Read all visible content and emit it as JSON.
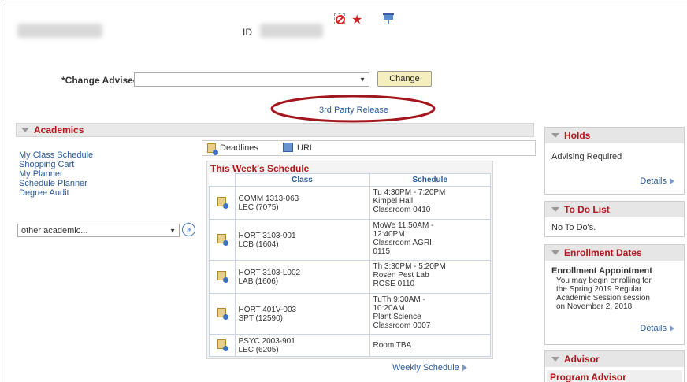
{
  "header": {
    "id_label": "ID",
    "change_advisee_label": "*Change Advisee",
    "change_button": "Change",
    "third_party_link": "3rd Party Release"
  },
  "academics": {
    "title": "Academics",
    "links": [
      "My Class Schedule",
      "Shopping Cart",
      "My Planner",
      "Schedule Planner",
      "Degree Audit"
    ],
    "other_select": "other academic...",
    "tabs": {
      "deadlines": "Deadlines",
      "url": "URL"
    },
    "schedule_title": "This Week's Schedule",
    "columns": [
      "Class",
      "Schedule"
    ],
    "rows": [
      {
        "class": [
          "COMM 1313-063",
          "LEC (7075)"
        ],
        "schedule": [
          "Tu 4:30PM - 7:20PM",
          "Kimpel Hall",
          "Classroom 0410"
        ]
      },
      {
        "class": [
          "HORT 3103-001",
          "LCB (1604)"
        ],
        "schedule": [
          "MoWe 11:50AM -",
          "12:40PM",
          "Classroom AGRI",
          "0115"
        ]
      },
      {
        "class": [
          "HORT 3103-L002",
          "LAB (1606)"
        ],
        "schedule": [
          "Th 3:30PM - 5:20PM",
          "Rosen Pest Lab",
          "ROSE 0110"
        ]
      },
      {
        "class": [
          "HORT 401V-003",
          "SPT (12590)"
        ],
        "schedule": [
          "TuTh 9:30AM -",
          "10:20AM",
          "Plant Science",
          "Classroom 0007"
        ]
      },
      {
        "class": [
          "PSYC 2003-901",
          "LEC (6205)"
        ],
        "schedule": [
          "Room  TBA"
        ]
      }
    ],
    "weekly_link": "Weekly Schedule"
  },
  "holds": {
    "title": "Holds",
    "text": "Advising Required",
    "details": "Details"
  },
  "todo": {
    "title": "To Do List",
    "text": "No To Do's."
  },
  "enrollment": {
    "title": "Enrollment Dates",
    "heading": "Enrollment Appointment",
    "text": [
      "You may begin enrolling for",
      "the Spring 2019 Regular",
      "Academic Session session",
      "on November 2, 2018."
    ],
    "details": "Details"
  },
  "advisor": {
    "title": "Advisor",
    "subtitle": "Program Advisor"
  },
  "colors": {
    "accent_red": "#b0161d",
    "link_blue": "#2a5a98",
    "oval": "#a3151c"
  }
}
